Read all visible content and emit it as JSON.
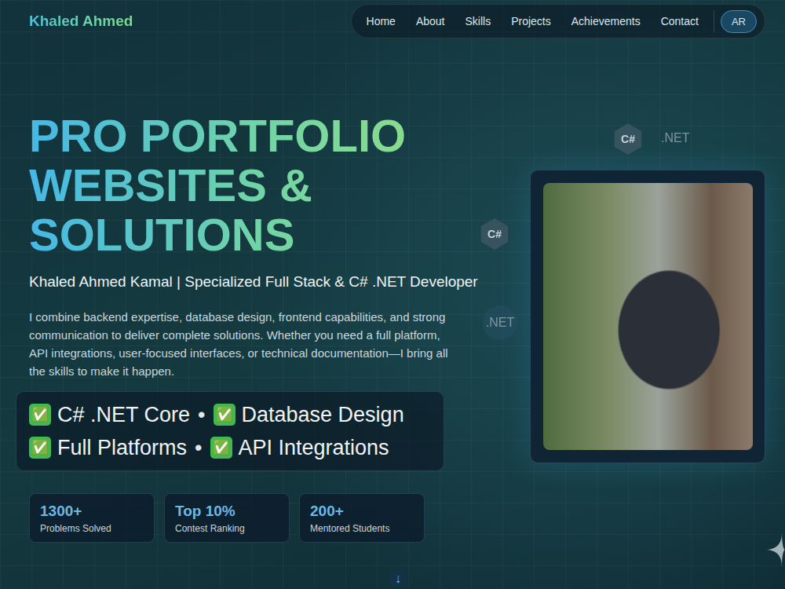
{
  "brand": "Khaled Ahmed",
  "nav": [
    {
      "label": "Home",
      "selected": false
    },
    {
      "label": "About",
      "selected": false
    },
    {
      "label": "Skills",
      "selected": false
    },
    {
      "label": "Projects",
      "selected": false
    },
    {
      "label": "Achievements",
      "selected": false
    },
    {
      "label": "Contact",
      "selected": false
    }
  ],
  "language": "AR",
  "hero": {
    "title": [
      "PRO PORTFOLIO",
      "WEBSITES &",
      "SOLUTIONS"
    ],
    "subtitle": "Khaled Ahmed Kamal | Specialized Full Stack & C# .NET Developer",
    "description": "I combine backend expertise, database design, frontend capabilities, and strong communication to deliver complete solutions. Whether you need a full platform, API integrations, user-focused interfaces, or technical documentation—I bring all the skills to make it happen."
  },
  "features": [
    [
      {
        "check": "✅",
        "label": "C# .NET Core"
      },
      {
        "check": "✅",
        "label": "Database Design"
      }
    ],
    [
      {
        "check": "✅",
        "label": "Full Platforms"
      },
      {
        "check": "✅",
        "label": "API Integrations"
      }
    ]
  ],
  "separator": "•",
  "stats": [
    {
      "value": "1300+",
      "label": "Problems Solved"
    },
    {
      "value": "Top 10%",
      "label": "Contest Ranking"
    },
    {
      "value": "200+",
      "label": "Mentored Students"
    }
  ],
  "badges": [
    {
      "kind": "hex",
      "text": "C#"
    },
    {
      "kind": "label",
      "text": ".NET"
    },
    {
      "kind": "hex",
      "text": "C#"
    },
    {
      "kind": "circle",
      "text": ".NET"
    }
  ],
  "scroll": "↓"
}
